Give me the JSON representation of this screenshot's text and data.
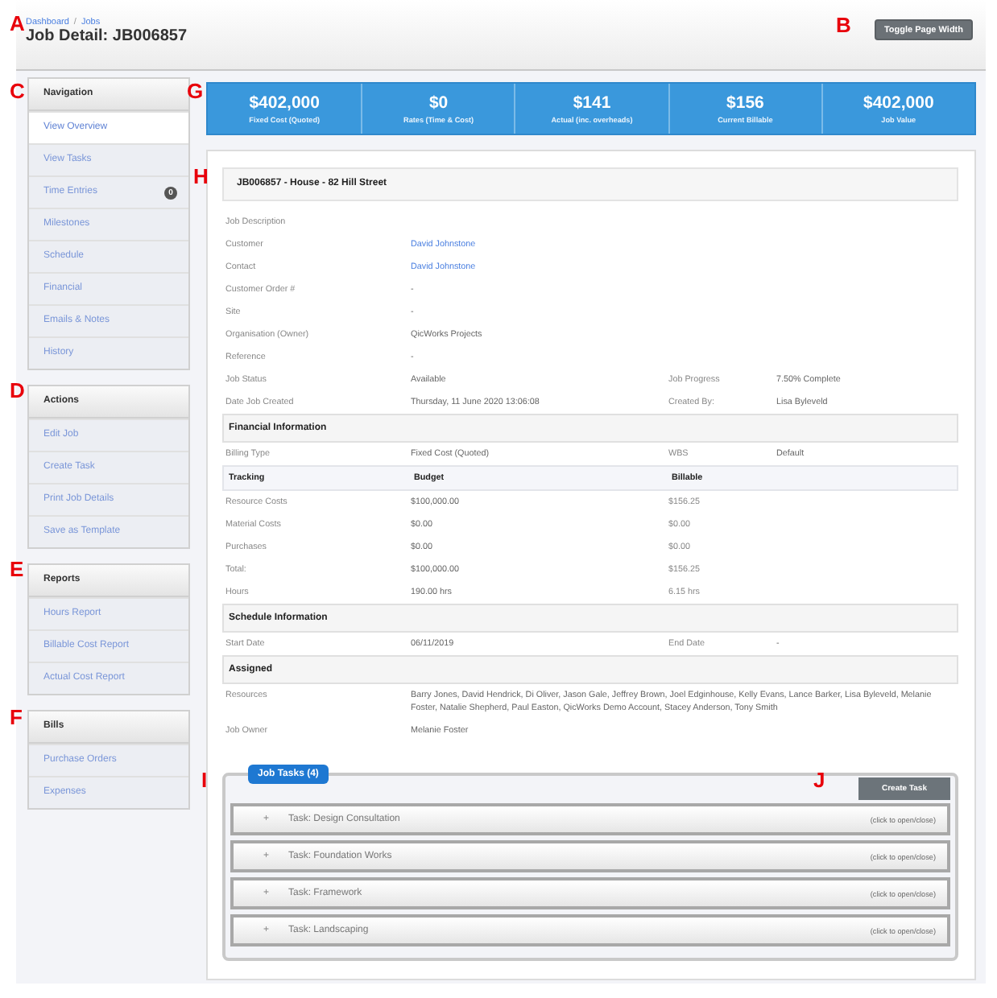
{
  "markers": [
    "A",
    "B",
    "C",
    "D",
    "E",
    "F",
    "G",
    "H",
    "I",
    "J"
  ],
  "header": {
    "breadcrumb": [
      "Dashboard",
      "Jobs"
    ],
    "separator": "/",
    "title": "Job Detail: JB006857",
    "button": "Toggle Page Width"
  },
  "sidebar": [
    {
      "title": "Navigation",
      "items": [
        {
          "label": "View Overview",
          "selected": true
        },
        {
          "label": "View Tasks",
          "selected": false
        },
        {
          "label": "Time Entries",
          "selected": false,
          "badge": "0"
        },
        {
          "label": "Milestones",
          "selected": false
        },
        {
          "label": "Schedule",
          "selected": false
        },
        {
          "label": "Financial",
          "selected": false
        },
        {
          "label": "Emails & Notes",
          "selected": false
        },
        {
          "label": "History",
          "selected": false
        }
      ]
    },
    {
      "title": "Actions",
      "items": [
        {
          "label": "Edit Job"
        },
        {
          "label": "Create Task"
        },
        {
          "label": "Print Job Details"
        },
        {
          "label": "Save as Template"
        }
      ]
    },
    {
      "title": "Reports",
      "items": [
        {
          "label": "Hours Report"
        },
        {
          "label": "Billable Cost Report"
        },
        {
          "label": "Actual Cost Report"
        }
      ]
    },
    {
      "title": "Bills",
      "items": [
        {
          "label": "Purchase Orders"
        },
        {
          "label": "Expenses"
        }
      ]
    }
  ],
  "stats": [
    {
      "value": "$402,000",
      "label": "Fixed Cost (Quoted)"
    },
    {
      "value": "$0",
      "label": "Rates (Time & Cost)"
    },
    {
      "value": "$141",
      "label": "Actual (inc. overheads)"
    },
    {
      "value": "$156",
      "label": "Current Billable"
    },
    {
      "value": "$402,000",
      "label": "Job Value"
    }
  ],
  "job": {
    "title": "JB006857 - House - 82 Hill Street",
    "blocks": [
      {
        "kind": "row",
        "cells": [
          {
            "text": "Job Description"
          }
        ]
      },
      {
        "kind": "row",
        "cells": [
          {
            "text": "Customer"
          },
          {
            "text": "David Johnstone",
            "link": true
          }
        ]
      },
      {
        "kind": "row",
        "cells": [
          {
            "text": "Contact"
          },
          {
            "text": "David Johnstone",
            "link": true
          }
        ]
      },
      {
        "kind": "row",
        "cells": [
          {
            "text": "Customer Order #"
          },
          {
            "text": "-"
          }
        ]
      },
      {
        "kind": "row",
        "cells": [
          {
            "text": "Site"
          },
          {
            "text": "-"
          }
        ]
      },
      {
        "kind": "row",
        "cells": [
          {
            "text": "Organisation (Owner)"
          },
          {
            "text": "QicWorks Projects"
          }
        ]
      },
      {
        "kind": "row",
        "cells": [
          {
            "text": "Reference"
          },
          {
            "text": "-"
          }
        ]
      },
      {
        "kind": "row",
        "cells": [
          {
            "text": "Job Status"
          },
          {
            "text": "Available"
          },
          {
            "text": "Job Progress"
          },
          {
            "text": "7.50% Complete"
          }
        ]
      },
      {
        "kind": "row",
        "cells": [
          {
            "text": "Date Job Created"
          },
          {
            "text": "Thursday, 11 June 2020 13:06:08"
          },
          {
            "text": "Created By:"
          },
          {
            "text": "Lisa Byleveld"
          }
        ]
      },
      {
        "kind": "section",
        "title": "Financial Information"
      },
      {
        "kind": "row",
        "cells": [
          {
            "text": "Billing Type"
          },
          {
            "text": "Fixed Cost (Quoted)"
          },
          {
            "text": "WBS"
          },
          {
            "text": "Default"
          }
        ]
      },
      {
        "kind": "header",
        "cells": [
          {
            "text": "Tracking"
          },
          {
            "text": "Budget"
          },
          {
            "text": "Billable"
          }
        ]
      },
      {
        "kind": "row",
        "cells": [
          {
            "text": "Resource Costs"
          },
          {
            "text": "$100,000.00"
          },
          {
            "text": "$156.25"
          }
        ]
      },
      {
        "kind": "row",
        "cells": [
          {
            "text": "Material Costs"
          },
          {
            "text": "$0.00"
          },
          {
            "text": "$0.00"
          }
        ]
      },
      {
        "kind": "row",
        "cells": [
          {
            "text": "Purchases"
          },
          {
            "text": "$0.00"
          },
          {
            "text": "$0.00"
          }
        ]
      },
      {
        "kind": "row",
        "cells": [
          {
            "text": "Total:"
          },
          {
            "text": "$100,000.00"
          },
          {
            "text": "$156.25"
          }
        ]
      },
      {
        "kind": "row",
        "cells": [
          {
            "text": "Hours"
          },
          {
            "text": "190.00 hrs"
          },
          {
            "text": "6.15 hrs"
          }
        ]
      },
      {
        "kind": "section",
        "title": "Schedule Information"
      },
      {
        "kind": "row",
        "cells": [
          {
            "text": "Start Date"
          },
          {
            "text": "06/11/2019"
          },
          {
            "text": "End Date"
          },
          {
            "text": "-"
          }
        ]
      },
      {
        "kind": "section",
        "title": "Assigned"
      },
      {
        "kind": "wide",
        "cells": [
          {
            "text": "Resources"
          },
          {
            "text": "Barry Jones, David Hendrick, Di Oliver, Jason Gale, Jeffrey Brown, Joel Edginhouse, Kelly Evans, Lance Barker, Lisa Byleveld, Melanie Foster, Natalie Shepherd, Paul Easton, QicWorks Demo Account, Stacey Anderson, Tony Smith"
          }
        ]
      },
      {
        "kind": "row",
        "cells": [
          {
            "text": "Job Owner"
          },
          {
            "text": "Melanie Foster"
          }
        ]
      }
    ]
  },
  "tasks": {
    "legend": "Job Tasks (4)",
    "button": "Create Task",
    "items": [
      {
        "expander": "+",
        "name": "Task: Design Consultation",
        "hint": "(click to open/close)"
      },
      {
        "expander": "+",
        "name": "Task: Foundation Works",
        "hint": "(click to open/close)"
      },
      {
        "expander": "+",
        "name": "Task: Framework",
        "hint": "(click to open/close)"
      },
      {
        "expander": "+",
        "name": "Task: Landscaping",
        "hint": "(click to open/close)"
      }
    ]
  }
}
